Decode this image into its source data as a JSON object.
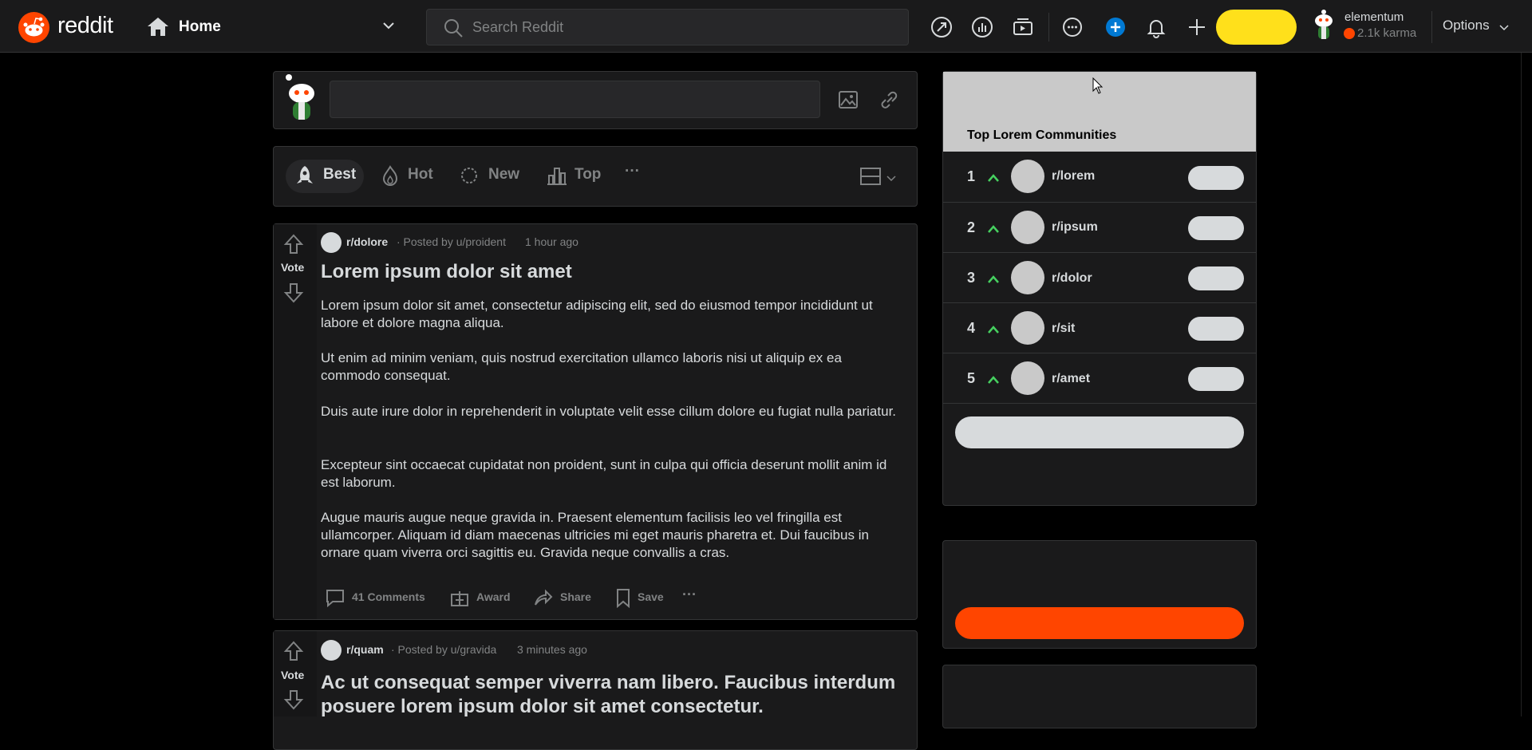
{
  "header": {
    "logo_text": "reddit",
    "home_label": "Home",
    "search_placeholder": "Search Reddit",
    "user_name": "elementum",
    "karma": "2.1k karma",
    "options_label": "Options",
    "icons": [
      "popular-icon",
      "stats-icon",
      "live-icon",
      "chat-icon",
      "advertise-icon",
      "notifications-icon",
      "create-post-icon"
    ]
  },
  "create_post": {
    "input_value": ""
  },
  "sort": {
    "best": "Best",
    "hot": "Hot",
    "new": "New",
    "top": "Top",
    "more": "···"
  },
  "posts": [
    {
      "vote_label": "Vote",
      "subreddit": "r/dolore",
      "meta": "· Posted by u/proident",
      "time": "1 hour ago",
      "title": "Lorem ipsum dolor sit amet",
      "paragraphs": [
        "Lorem ipsum dolor sit amet, consectetur adipiscing elit, sed do eiusmod tempor incididunt ut labore et dolore magna aliqua.",
        "Ut enim ad minim veniam, quis nostrud exercitation ullamco laboris nisi ut aliquip ex ea commodo consequat.",
        "Duis aute irure dolor in reprehenderit in voluptate velit esse cillum dolore eu fugiat nulla pariatur.",
        "Excepteur sint occaecat cupidatat non proident, sunt in culpa qui officia deserunt mollit anim id est laborum.",
        "Augue mauris augue neque gravida in. Praesent elementum facilisis leo vel fringilla est ullamcorper. Aliquam id diam maecenas ultricies mi eget mauris pharetra et. Dui faucibus in ornare quam viverra orci sagittis eu. Gravida neque convallis a cras."
      ],
      "actions": {
        "comments": "41 Comments",
        "award": "Award",
        "share": "Share",
        "save": "Save",
        "more": "···"
      }
    },
    {
      "vote_label": "Vote",
      "subreddit": "r/quam",
      "meta": "· Posted by u/gravida",
      "time": "3 minutes ago",
      "title": "Ac ut consequat semper viverra nam libero. Faucibus interdum posuere lorem ipsum dolor sit amet consectetur."
    }
  ],
  "sidebar": {
    "top_communities": {
      "title": "Top Lorem Communities",
      "items": [
        {
          "rank": "1",
          "name": "r/lorem"
        },
        {
          "rank": "2",
          "name": "r/ipsum"
        },
        {
          "rank": "3",
          "name": "r/dolor"
        },
        {
          "rank": "4",
          "name": "r/sit"
        },
        {
          "rank": "5",
          "name": "r/amet"
        }
      ]
    }
  },
  "colors": {
    "brand": "#ff4500",
    "coins": "#ffe01b",
    "upvote_green": "#46d160",
    "bg": "#000000",
    "card": "#1a1a1b"
  }
}
